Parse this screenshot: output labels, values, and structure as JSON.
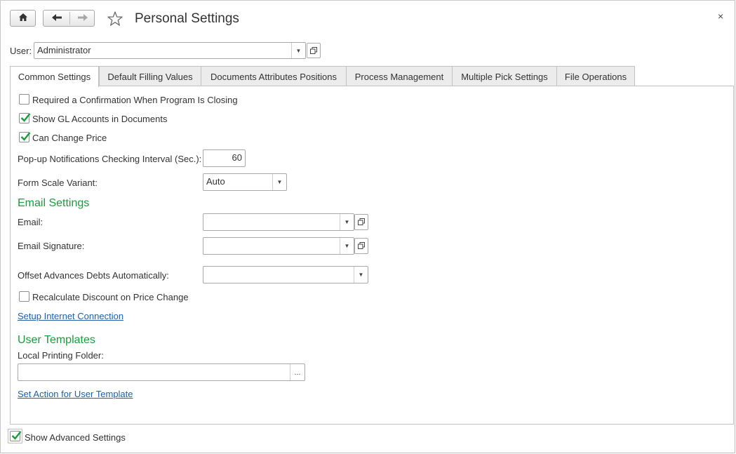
{
  "window": {
    "title": "Personal Settings",
    "close_label": "×"
  },
  "toolbar": {
    "home_icon": "home-icon",
    "back_icon": "arrow-left-icon",
    "forward_icon": "arrow-right-icon",
    "favorite_icon": "star-icon"
  },
  "user": {
    "label": "User:",
    "value": "Administrator"
  },
  "tabs": [
    {
      "label": "Common Settings",
      "active": true
    },
    {
      "label": "Default Filling Values",
      "active": false
    },
    {
      "label": "Documents Attributes Positions",
      "active": false
    },
    {
      "label": "Process Management",
      "active": false
    },
    {
      "label": "Multiple Pick Settings",
      "active": false
    },
    {
      "label": "File Operations",
      "active": false
    }
  ],
  "common": {
    "confirm_on_close": {
      "label": "Required a Confirmation When Program Is Closing",
      "checked": false
    },
    "show_gl_accounts": {
      "label": "Show GL Accounts in Documents",
      "checked": true
    },
    "can_change_price": {
      "label": "Can Change Price",
      "checked": true
    },
    "popup_interval": {
      "label": "Pop-up Notifications Checking Interval (Sec.):",
      "value": "60"
    },
    "form_scale": {
      "label": "Form Scale Variant:",
      "value": "Auto"
    }
  },
  "email": {
    "heading": "Email Settings",
    "email_label": "Email:",
    "email_value": "",
    "signature_label": "Email Signature:",
    "signature_value": "",
    "offset_label": "Offset Advances Debts Automatically:",
    "offset_value": "",
    "recalc_discount": {
      "label": "Recalculate Discount on Price Change",
      "checked": false
    },
    "setup_link": "Setup Internet Connection"
  },
  "templates": {
    "heading": "User Templates",
    "folder_label": "Local Printing Folder:",
    "folder_value": "",
    "browse_label": "...",
    "action_link": "Set Action for User Template"
  },
  "footer": {
    "show_advanced": {
      "label": "Show Advanced Settings",
      "checked": true
    }
  },
  "colors": {
    "section_heading": "#179e3a",
    "link": "#1f5fa8",
    "focus_border": "#e8c34a"
  }
}
